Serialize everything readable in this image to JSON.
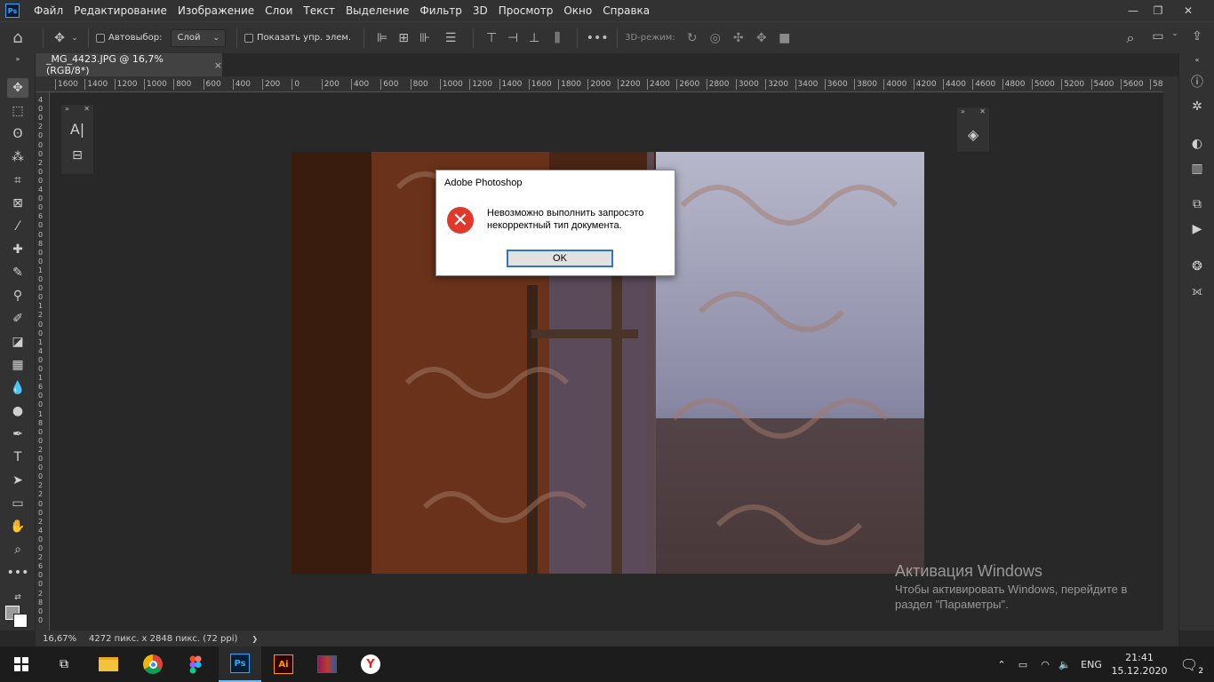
{
  "app": {
    "logo": "Ps"
  },
  "menu": [
    "Файл",
    "Редактирование",
    "Изображение",
    "Слои",
    "Текст",
    "Выделение",
    "Фильтр",
    "3D",
    "Просмотр",
    "Окно",
    "Справка"
  ],
  "window_controls": {
    "minimize": "—",
    "restore": "❐",
    "close": "✕"
  },
  "options": {
    "autoselect_label": "Автовыбор:",
    "autoselect_value": "Слой",
    "show_controls_label": "Показать упр. элем.",
    "mode3d_label": "3D-режим:"
  },
  "document_tab": {
    "title": "_MG_4423.JPG @ 16,7% (RGB/8*)",
    "close": "×"
  },
  "ruler_h_ticks": [
    "1600",
    "1400",
    "1200",
    "1000",
    "800",
    "600",
    "400",
    "200",
    "0",
    "200",
    "400",
    "600",
    "800",
    "1000",
    "1200",
    "1400",
    "1600",
    "1800",
    "2000",
    "2200",
    "2400",
    "2600",
    "2800",
    "3000",
    "3200",
    "3400",
    "3600",
    "3800",
    "4000",
    "4200",
    "4400",
    "4600",
    "4800",
    "5000",
    "5200",
    "5400",
    "5600",
    "58"
  ],
  "ruler_v_ticks": [
    "4",
    "0",
    "0",
    "2",
    "0",
    "0",
    "0",
    "2",
    "0",
    "0",
    "4",
    "0",
    "0",
    "6",
    "0",
    "0",
    "8",
    "0",
    "0",
    "1",
    "0",
    "0",
    "0",
    "1",
    "2",
    "0",
    "0",
    "1",
    "4",
    "0",
    "0",
    "1",
    "6",
    "0",
    "0",
    "1",
    "8",
    "0",
    "0",
    "2",
    "0",
    "0",
    "0",
    "2",
    "2",
    "0",
    "0",
    "2",
    "4",
    "0",
    "0",
    "2",
    "6",
    "0",
    "0",
    "2",
    "8",
    "0",
    "0"
  ],
  "status": {
    "zoom": "16,67%",
    "info": "4272 пикс. x 2848 пикс. (72 ppi)",
    "arrow": "❯"
  },
  "dialog": {
    "title": "Adobe Photoshop",
    "message": "Невозможно выполнить запросэто некорректный тип документа.",
    "ok": "OK",
    "icon": "✕"
  },
  "watermark": {
    "title": "Активация Windows",
    "line1": "Чтобы активировать Windows, перейдите в",
    "line2": "раздел \"Параметры\"."
  },
  "taskbar": {
    "lang": "ENG",
    "time": "21:41",
    "date": "15.12.2020",
    "notifications": "2",
    "ps_label": "Ps",
    "ai_label": "Ai",
    "yandex_label": "Y"
  },
  "colors": {
    "accent": "#31a8ff",
    "dialog_error": "#e0392b",
    "ok_border": "#2f76c4",
    "ai_color": "#ff9a00"
  }
}
